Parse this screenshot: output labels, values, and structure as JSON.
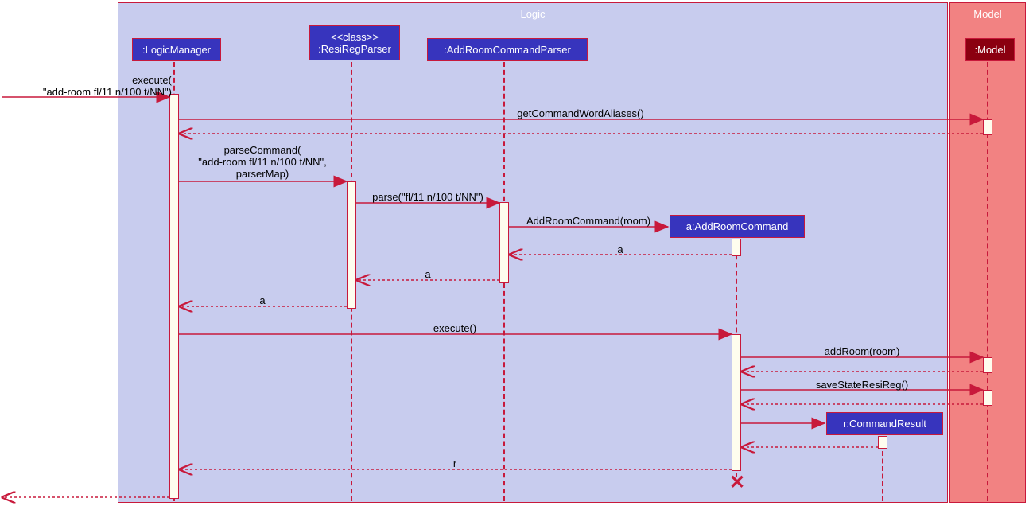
{
  "frames": {
    "logic": "Logic",
    "model": "Model"
  },
  "participants": {
    "logicManager": ":LogicManager",
    "resiRegParser_line1": "<<class>>",
    "resiRegParser_line2": ":ResiRegParser",
    "addRoomCommandParser": ":AddRoomCommandParser",
    "addRoomCommand": "a:AddRoomCommand",
    "commandResult": "r:CommandResult",
    "model": ":Model"
  },
  "messages": {
    "execute_in_line1": "execute(",
    "execute_in_line2": "\"add-room fl/11 n/100 t/NN\")",
    "getCommandWordAliases": "getCommandWordAliases()",
    "parseCommand_line1": "parseCommand(",
    "parseCommand_line2": "\"add-room fl/11 n/100 t/NN\",",
    "parseCommand_line3": "parserMap)",
    "parse": "parse(\"fl/11 n/100 t/NN\")",
    "addRoomCommandCtor": "AddRoomCommand(room)",
    "return_a1": "a",
    "return_a2": "a",
    "return_a3": "a",
    "execute2": "execute()",
    "addRoom": "addRoom(room)",
    "saveState": "saveStateResiReg()",
    "return_r": "r"
  }
}
